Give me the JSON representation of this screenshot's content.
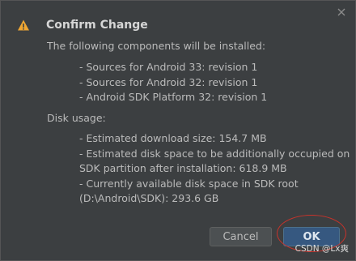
{
  "dialog": {
    "title": "Confirm Change",
    "intro": "The following components will be installed:",
    "components": [
      "- Sources for Android 33: revision 1",
      "- Sources for Android 32: revision 1",
      "- Android SDK Platform 32: revision 1"
    ],
    "disk_usage_label": "Disk usage:",
    "disk_lines": [
      "- Estimated download size: 154.7 MB",
      "- Estimated disk space to be additionally occupied on",
      "SDK partition after installation: 618.9 MB",
      "- Currently available disk space in SDK root",
      "(D:\\Android\\SDK): 293.6 GB"
    ]
  },
  "buttons": {
    "cancel_label": "Cancel",
    "ok_label": "OK"
  },
  "watermark": "CSDN @Lx爽",
  "icons": {
    "warning": "warning-icon",
    "close": "close-icon"
  },
  "colors": {
    "background": "#3c3f41",
    "ok_button": "#365880",
    "warning": "#f0a732",
    "annotation": "#c8332b"
  }
}
